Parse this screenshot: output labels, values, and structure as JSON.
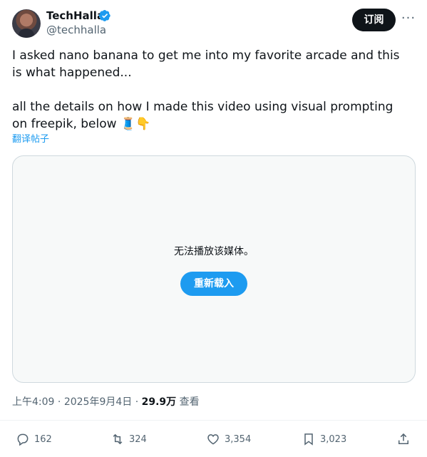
{
  "author": {
    "name": "TechHalla",
    "handle": "@techhalla",
    "verified_color": "#1d9bf0"
  },
  "header": {
    "subscribe_label": "订阅",
    "more_label": "···"
  },
  "tweet": {
    "text": "I asked nano banana to get me into my favorite arcade and this is what happened...\n\nall the details on how I made this video using visual prompting on freepik, below 🧵👇",
    "translate_label": "翻译帖子"
  },
  "media": {
    "message": "无法播放该媒体。",
    "reload_label": "重新载入"
  },
  "meta": {
    "time": "上午4:09",
    "separator": "·",
    "date": "2025年9月4日",
    "views_count": "29.9万",
    "views_label": "查看"
  },
  "actions": {
    "replies": "162",
    "reposts": "324",
    "likes": "3,354",
    "bookmarks": "3,023"
  },
  "colors": {
    "text": "#0f1419",
    "secondary": "#536471",
    "accent": "#1d9bf0",
    "border": "#cfd9de"
  }
}
